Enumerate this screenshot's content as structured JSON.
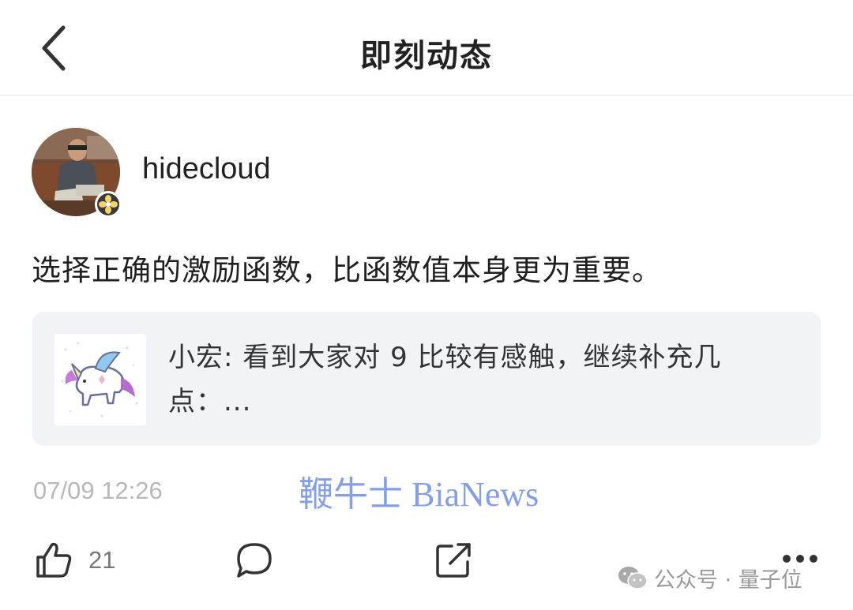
{
  "header": {
    "title": "即刻动态"
  },
  "post": {
    "author": "hidecloud",
    "text": "选择正确的激励函数，比函数值本身更为重要。",
    "quote": {
      "line1": "小宏: 看到大家对 9 比较有感触，继续补充几",
      "line2": "点：..."
    },
    "time": "07/09 12:26",
    "likes": "21"
  },
  "watermark": "鞭牛士 BiaNews",
  "footer_watermark": "公众号 · 量子位",
  "icons": {
    "back": "chevron-left-icon",
    "like": "thumbs-up-icon",
    "comment": "speech-bubble-icon",
    "share": "share-out-icon",
    "more": "more-dots-icon",
    "wechat": "wechat-icon"
  },
  "colors": {
    "watermark": "#6f8fe4",
    "quote_bg": "#f1f3f6",
    "muted": "#b8b8b8"
  }
}
